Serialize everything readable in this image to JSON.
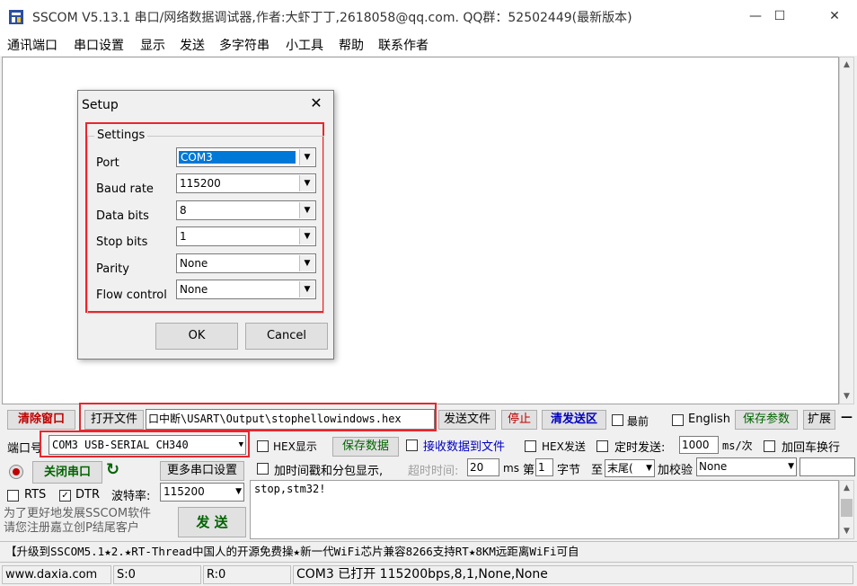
{
  "window": {
    "title": "SSCOM V5.13.1 串口/网络数据调试器,作者:大虾丁丁,2618058@qq.com. QQ群：52502449(最新版本)",
    "minimize": "—",
    "maximize": "☐",
    "close": "✕"
  },
  "menu": [
    "通讯端口",
    "串口设置",
    "显示",
    "发送",
    "多字符串",
    "小工具",
    "帮助",
    "联系作者"
  ],
  "setup_dialog": {
    "title": "Setup",
    "close": "✕",
    "group_label": "Settings",
    "fields": [
      {
        "label": "Port",
        "value": "COM3"
      },
      {
        "label": "Baud rate",
        "value": "115200"
      },
      {
        "label": "Data bits",
        "value": "8"
      },
      {
        "label": "Stop bits",
        "value": "1"
      },
      {
        "label": "Parity",
        "value": "None"
      },
      {
        "label": "Flow control",
        "value": "None"
      }
    ],
    "ok": "OK",
    "cancel": "Cancel"
  },
  "toolbar1": {
    "clear": "清除窗口",
    "open_file": "打开文件",
    "file_path": "口中断\\USART\\Output\\stophellowindows.hex",
    "send_file": "发送文件",
    "stop": "停止",
    "clear_send": "清发送区",
    "topmost": "最前",
    "english": "English",
    "save_params": "保存参数",
    "expand": "扩展",
    "collapse": "—"
  },
  "row2": {
    "port_label": "端口号",
    "port_value": "COM3 USB-SERIAL CH340",
    "hex_display": "HEX显示",
    "save_data": "保存数据",
    "recv_to_file": "接收数据到文件",
    "hex_send": "HEX发送",
    "timed_send": "定时发送:",
    "interval": "1000",
    "interval_unit": "ms/次",
    "add_crlf": "加回车换行"
  },
  "row3": {
    "close_port": "关闭串口",
    "refresh_icon": "↻",
    "more_settings": "更多串口设置",
    "timestamp": "加时间戳和分包显示,",
    "timeout_label": "超时时间:",
    "timeout": "20",
    "timeout_unit": "ms",
    "nth": "第",
    "byte_index": "1",
    "byte_label": "字节",
    "to": "至",
    "end": "末尾(",
    "checksum": "加校验",
    "checksum_value": "None"
  },
  "row4": {
    "rts": "RTS",
    "dtr": "DTR",
    "check_mark": "✓",
    "baud_label": "波特率:",
    "baud_value": "115200"
  },
  "send_area": {
    "text": "stop,stm32!",
    "promo": "为了更好地发展SSCOM软件\n请您注册嘉立创P结尾客户",
    "send": "发 送"
  },
  "ticker": "【升级到SSCOM5.1★2.★RT-Thread中国人的开源免费操★新一代WiFi芯片兼容8266支持RT★8KM远距离WiFi可自",
  "status": {
    "url": "www.daxia.com",
    "sent": "S:0",
    "received": "R:0",
    "port_state": "COM3 已打开  115200bps,8,1,None,None"
  },
  "colors": {
    "highlight_red": "#e8262d",
    "selection": "#0078d7"
  }
}
